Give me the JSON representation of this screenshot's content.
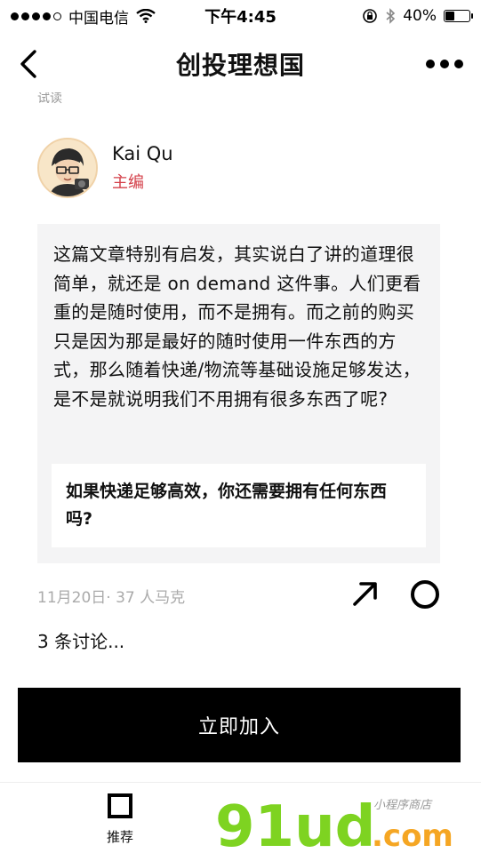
{
  "status_bar": {
    "carrier": "中国电信",
    "time": "下午4:45",
    "battery": "40%",
    "battery_level": 0.4
  },
  "nav": {
    "title": "创投理想国"
  },
  "cut_text": "试读",
  "author": {
    "name": "Kai Qu",
    "role": "主编"
  },
  "post": {
    "body": "这篇文章特别有启发，其实说白了讲的道理很简单，就还是 on demand 这件事。人们更看重的是随时使用，而不是拥有。而之前的购买只是因为那是最好的随时使用一件东西的方式，那么随着快递/物流等基础设施足够发达，是不是就说明我们不用拥有很多东西了呢?",
    "quote": "如果快递足够高效，你还需要拥有任何东西吗?"
  },
  "meta": {
    "date_marks": "11月20日· 37 人马克"
  },
  "discussion": "3 条讨论...",
  "join_button": "立即加入",
  "tab_bar": {
    "recommend": "推荐"
  },
  "watermark": {
    "brand": "91ud",
    "suffix": ".com",
    "tagline": "小程序商店"
  },
  "colors": {
    "accent_red": "#d4404a",
    "card_bg": "#f4f4f5",
    "watermark_green": "#7ed321",
    "watermark_orange": "#f5a623"
  }
}
